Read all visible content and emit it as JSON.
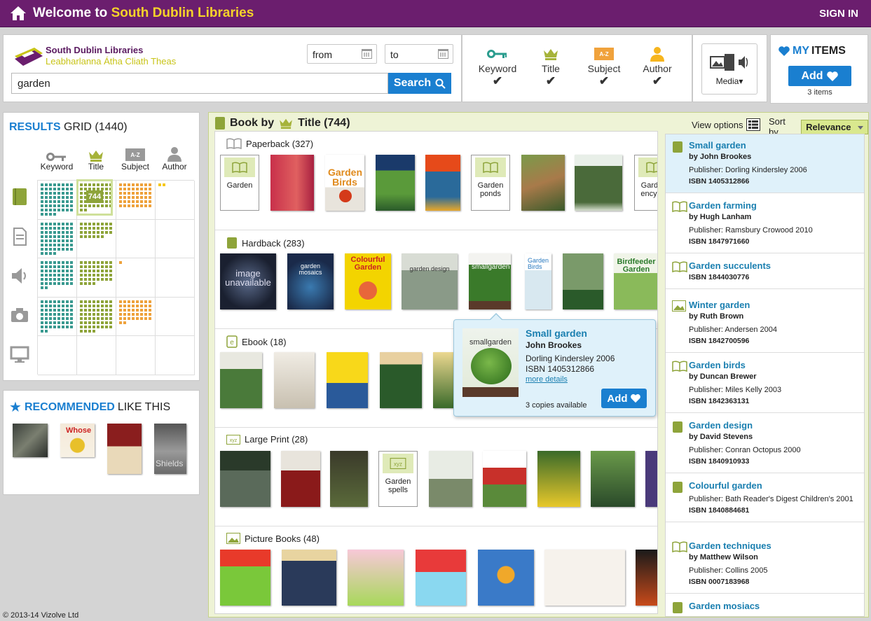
{
  "header": {
    "welcome": "Welcome to ",
    "library": "South Dublin Libraries",
    "sign_in": "SIGN IN"
  },
  "brand": {
    "name": "South Dublin Libraries",
    "irish": "Leabharlanna Átha Cliath Theas"
  },
  "search": {
    "from": "from",
    "to": "to",
    "query": "garden",
    "button": "Search"
  },
  "types": [
    {
      "label": "Keyword",
      "icon": "key-icon",
      "check": "✔"
    },
    {
      "label": "Title",
      "icon": "crown-icon",
      "check": "✔"
    },
    {
      "label": "Subject",
      "icon": "subject-icon",
      "check": "✔"
    },
    {
      "label": "Author",
      "icon": "person-icon",
      "check": "✔"
    }
  ],
  "media": {
    "label": "Media"
  },
  "my_items": {
    "my": "MY",
    "items": "ITEMS",
    "add": "Add",
    "count": "3 items"
  },
  "results_grid": {
    "results": "RESULTS",
    "grid": "GRID (1440)",
    "columns": [
      "Keyword",
      "Title",
      "Subject",
      "Author"
    ],
    "selected_count": "744"
  },
  "recommended": {
    "rec": "RECOMMENDED",
    "like": "LIKE THIS"
  },
  "footer": "© 2013-14 Vizolve Ltd",
  "main": {
    "book_by": "Book by",
    "title": "Title (744)",
    "view_options": "View options",
    "sort_by": "Sort by",
    "sort_value": "Relevance"
  },
  "shelves": [
    {
      "label": "Paperback (327)",
      "placeholders": [
        "Garden",
        "Garden ponds",
        "Garden encyclo"
      ]
    },
    {
      "label": "Hardback (283)",
      "covers": {
        "unavailable": "image unavailable",
        "mosaics": "garden mosaics",
        "colourful": "Colourful Garden",
        "design": "garden design",
        "small": "smallgarden",
        "birds": "Garden Birds",
        "birdfeeder": "Birdfeeder Garden"
      }
    },
    {
      "label": "Ebook (18)"
    },
    {
      "label": "Large Print (28)",
      "placeholders": [
        "Garden spells"
      ]
    },
    {
      "label": "Picture Books (48)"
    }
  ],
  "list": [
    {
      "title": "Small garden",
      "author": "by John Brookes",
      "publisher": "Publisher: Dorling Kindersley 2006",
      "isbn": "ISBN 1405312866"
    },
    {
      "title": "Garden farming",
      "author": "by Hugh Lanham",
      "publisher": "Publisher: Ramsbury Crowood 2010",
      "isbn": "ISBN 1847971660"
    },
    {
      "title": "Garden succulents",
      "isbn": "ISBN 1844030776"
    },
    {
      "title": "Winter garden",
      "author": "by Ruth Brown",
      "publisher": "Publisher: Andersen 2004",
      "isbn": "ISBN 1842700596"
    },
    {
      "title": "Garden birds",
      "author": "by Duncan Brewer",
      "publisher": "Publisher: Miles Kelly 2003",
      "isbn": "ISBN 1842363131"
    },
    {
      "title": "Garden design",
      "author": "by David Stevens",
      "publisher": "Publisher: Conran Octopus 2000",
      "isbn": "ISBN 1840910933"
    },
    {
      "title": "Colourful garden",
      "publisher": "Publisher: Bath Reader's Digest Children's 2001",
      "isbn": "ISBN 1840884681"
    },
    {
      "title": "Garden techniques",
      "author": "by Matthew Wilson",
      "publisher": "Publisher: Collins 2005",
      "isbn": "ISBN 0007183968"
    },
    {
      "title": "Garden mosiacs"
    }
  ],
  "popup": {
    "title": "Small garden",
    "author": "John Brookes",
    "publisher": "Dorling Kindersley 2006",
    "isbn": "ISBN 1405312866",
    "more": "more details",
    "copies": "3 copies available",
    "add": "Add"
  },
  "colors": {
    "topbar": "#6b1e6e",
    "accent": "#1a7fd0",
    "yellow": "#f6d32a",
    "green": "#8ea43a",
    "teal": "#3a9a90",
    "orange": "#eea23c"
  }
}
